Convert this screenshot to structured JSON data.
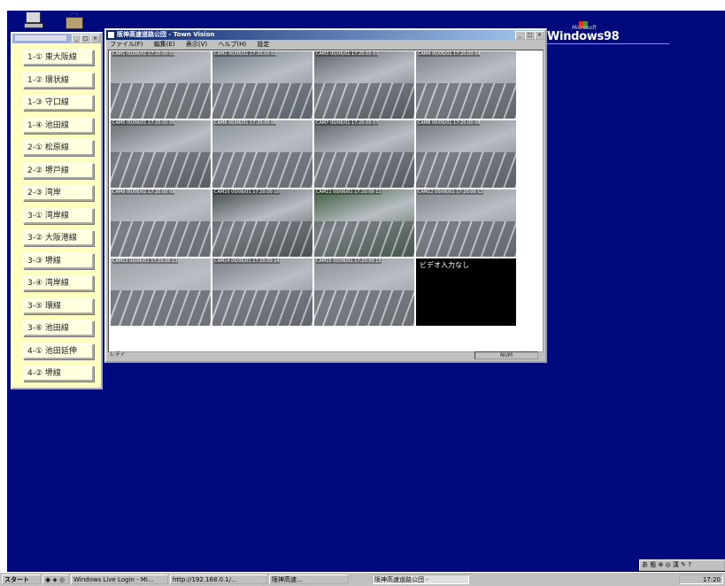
{
  "colors": {
    "desktop": "#000a7d",
    "panel": "#ffffc0",
    "titlebar": "#0a246a"
  },
  "desktop": {
    "icons": [
      "my-computer-icon",
      "briefcase-icon"
    ],
    "logo": {
      "microsoft": "Microsoft",
      "text": "Windows98"
    }
  },
  "launcher": {
    "title": "",
    "routes": [
      "1-① 東大阪線",
      "1-② 環状線",
      "1-③ 守口線",
      "1-④ 池田線",
      "2-① 松原線",
      "2-② 堺戸線",
      "2-③ 湾岸",
      "3-① 湾岸線",
      "3-② 大阪港線",
      "3-③ 堺線",
      "3-④ 湾岸線",
      "3-⑤ 環線",
      "3-⑥ 池田線",
      "4-① 池田延伸",
      "4-② 堺線"
    ]
  },
  "viewer": {
    "title": "阪神高速道路公団 - Town Vision",
    "menu": [
      "ファイル(F)",
      "編集(E)",
      "表示(V)",
      "ヘルプ(H)",
      "設定"
    ],
    "cameras": [
      {
        "ts": "CAM1 00/06/01 17:20:00 01"
      },
      {
        "ts": "CAM2 00/06/01 17:20:00 02"
      },
      {
        "ts": "CAM3 00/06/01 17:20:00 03"
      },
      {
        "ts": "CAM4 00/06/01 17:20:00 04"
      },
      {
        "ts": "CAM5 00/06/01 17:20:00 05"
      },
      {
        "ts": "CAM6 00/06/01 17:20:00 06"
      },
      {
        "ts": "CAM7 00/06/01 17:20:00 07"
      },
      {
        "ts": "CAM8 00/06/01 17:20:00 08"
      },
      {
        "ts": "CAM9 00/06/01 17:20:00 09"
      },
      {
        "ts": "CAM10 00/06/01 17:20:00 10"
      },
      {
        "ts": "CAM11 00/06/01 17:20:00 11"
      },
      {
        "ts": "CAM12 00/06/01 17:20:00 12"
      },
      {
        "ts": "CAM13 00/06/01 17:20:00 13"
      },
      {
        "ts": "CAM14 00/06/01 17:20:00 14"
      },
      {
        "ts": "CAM15 00/06/01 17:20:00 15"
      },
      {
        "ts": "ビデオ入力なし"
      }
    ],
    "status_left": "レディ",
    "status_right": "NUM"
  },
  "taskbar": {
    "start": "スタート",
    "tasks": [
      "Windows Live Login - Mi...",
      "http://192.168.0.1/...",
      "阪神高速...",
      "阪神高速道路公団 -"
    ],
    "tray": "17:20"
  },
  "ime": "あ 般 ⊕ ◎ 漢 ✎ ?"
}
